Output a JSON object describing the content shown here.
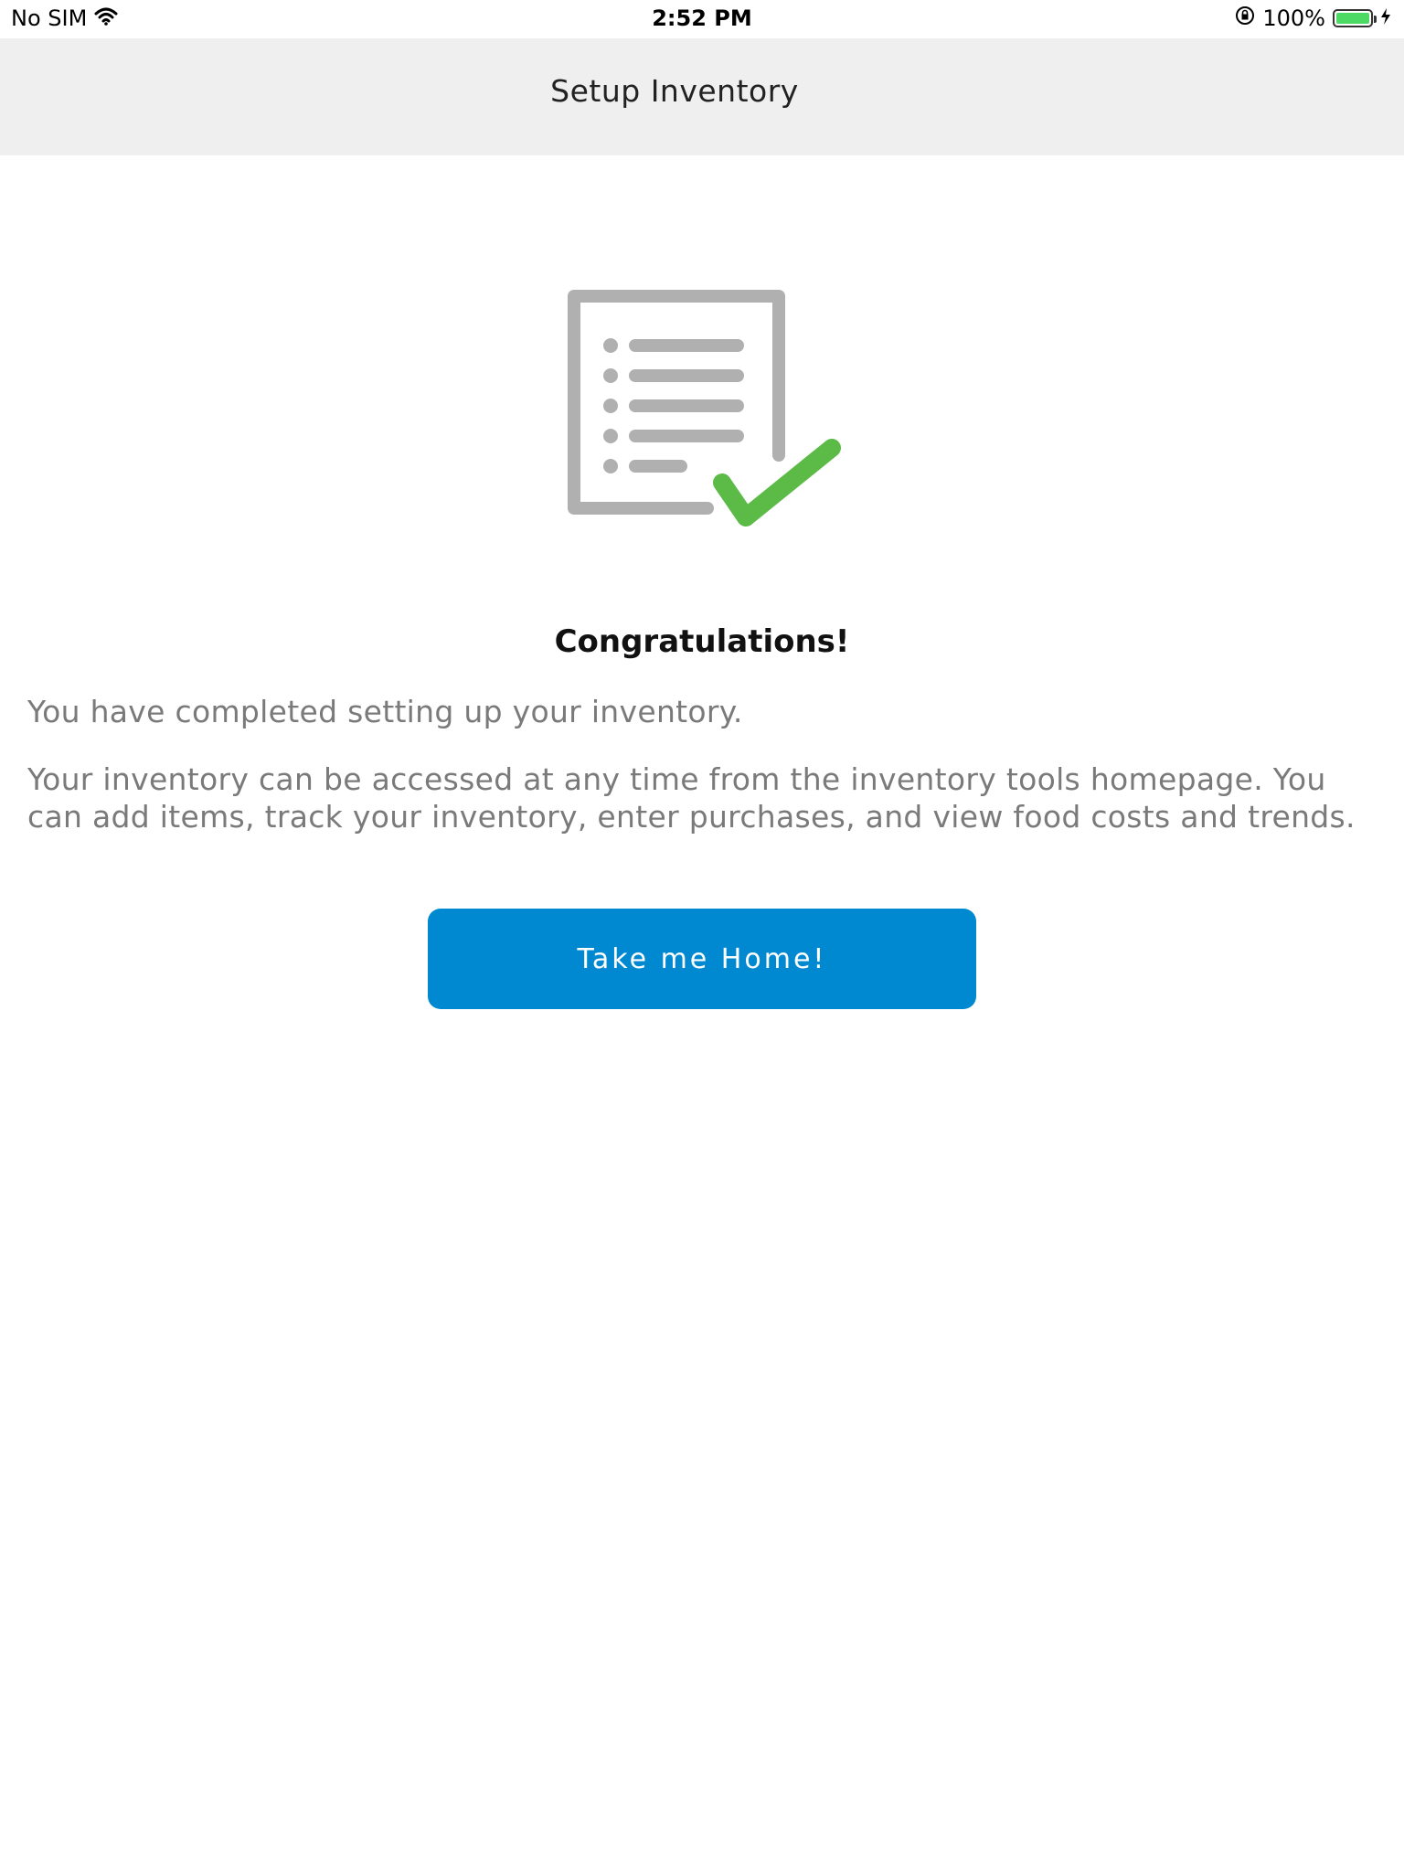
{
  "status_bar": {
    "carrier": "No SIM",
    "time": "2:52 PM",
    "battery_percent": "100%",
    "battery_level": 1.0,
    "icons": [
      "wifi-icon",
      "rotation-lock-icon",
      "battery-icon",
      "charging-icon"
    ]
  },
  "nav": {
    "title": "Setup Inventory"
  },
  "hero": {
    "icon": "inventory-checklist-icon",
    "colors": {
      "document": "#b0b0b0",
      "check": "#5cbb47"
    }
  },
  "content": {
    "title": "Congratulations!",
    "paragraph1": "You have completed setting up your inventory.",
    "paragraph2": "Your inventory can be accessed at any time from the inventory tools homepage. You can add items, track your inventory, enter purchases, and view food costs and trends."
  },
  "actions": {
    "home_button_label": "Take me Home!",
    "button_color": "#0088d1"
  }
}
